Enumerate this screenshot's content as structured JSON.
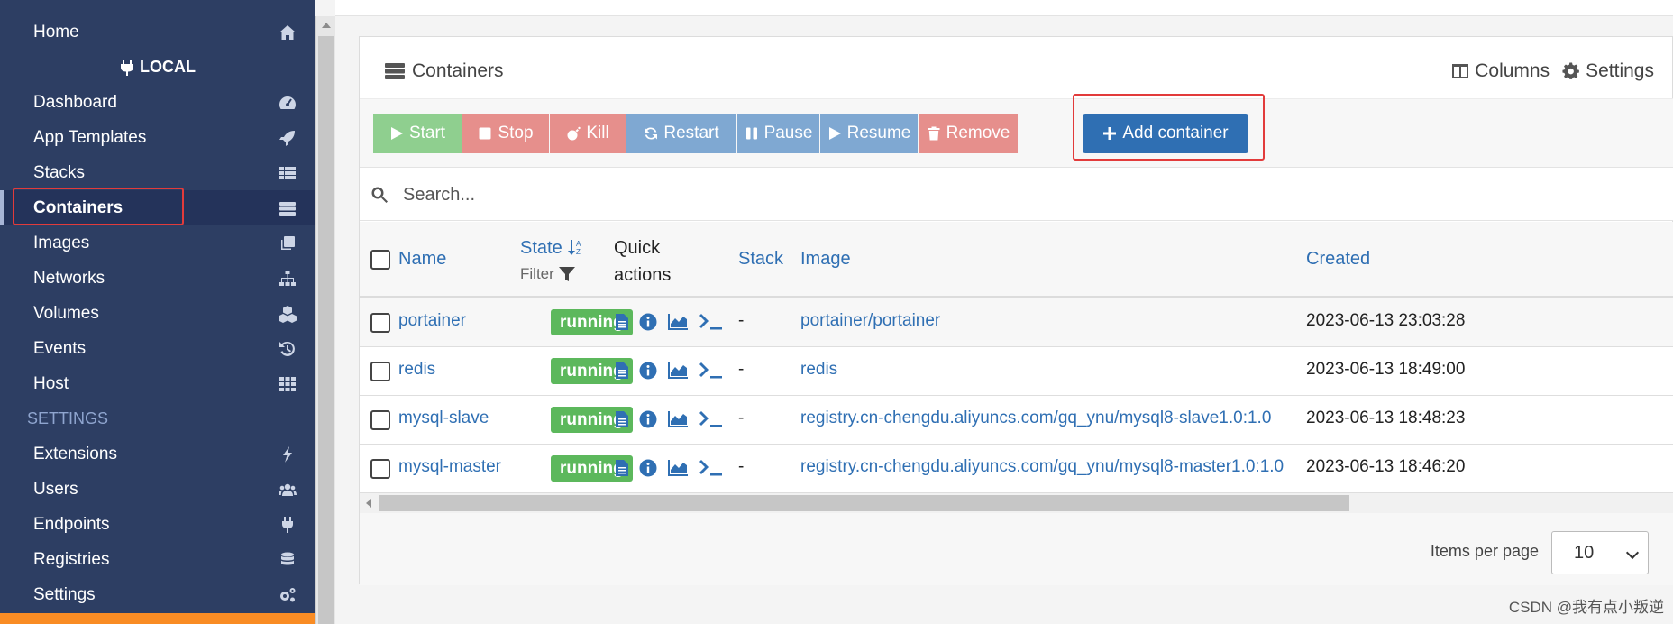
{
  "sidebar": {
    "home": "Home",
    "endpoint_header": "LOCAL",
    "items": [
      {
        "label": "Dashboard",
        "icon": "dashboard-icon"
      },
      {
        "label": "App Templates",
        "icon": "rocket-icon"
      },
      {
        "label": "Stacks",
        "icon": "list-icon"
      },
      {
        "label": "Containers",
        "icon": "server-icon"
      },
      {
        "label": "Images",
        "icon": "copy-icon"
      },
      {
        "label": "Networks",
        "icon": "sitemap-icon"
      },
      {
        "label": "Volumes",
        "icon": "cubes-icon"
      },
      {
        "label": "Events",
        "icon": "history-icon"
      },
      {
        "label": "Host",
        "icon": "grid-icon"
      }
    ],
    "settings_section": "SETTINGS",
    "settings_items": [
      {
        "label": "Extensions",
        "icon": "bolt-icon"
      },
      {
        "label": "Users",
        "icon": "users-icon"
      },
      {
        "label": "Endpoints",
        "icon": "plug-icon"
      },
      {
        "label": "Registries",
        "icon": "database-icon"
      },
      {
        "label": "Settings",
        "icon": "cogs-icon"
      }
    ],
    "accent_color": "#2d3e63"
  },
  "panel": {
    "title": "Containers",
    "columns_label": "Columns",
    "settings_label": "Settings"
  },
  "actions": {
    "start": "Start",
    "stop": "Stop",
    "kill": "Kill",
    "restart": "Restart",
    "pause": "Pause",
    "resume": "Resume",
    "remove": "Remove",
    "add": "Add container"
  },
  "search": {
    "placeholder": "Search..."
  },
  "table": {
    "headers": {
      "name": "Name",
      "state": "State",
      "filter": "Filter",
      "quick_actions_1": "Quick",
      "quick_actions_2": "actions",
      "stack": "Stack",
      "image": "Image",
      "created": "Created"
    },
    "rows": [
      {
        "name": "portainer",
        "state": "running",
        "stack": "-",
        "image": "portainer/portainer",
        "created": "2023-06-13 23:03:28"
      },
      {
        "name": "redis",
        "state": "running",
        "stack": "-",
        "image": "redis",
        "created": "2023-06-13 18:49:00"
      },
      {
        "name": "mysql-slave",
        "state": "running",
        "stack": "-",
        "image": "registry.cn-chengdu.aliyuncs.com/gq_ynu/mysql8-slave1.0:1.0",
        "created": "2023-06-13 18:48:23"
      },
      {
        "name": "mysql-master",
        "state": "running",
        "stack": "-",
        "image": "registry.cn-chengdu.aliyuncs.com/gq_ynu/mysql8-master1.0:1.0",
        "created": "2023-06-13 18:46:20"
      }
    ],
    "status_color": "#5cb85c"
  },
  "pagination": {
    "items_per_page_label": "Items per page",
    "items_per_page_value": "10"
  },
  "watermark": "CSDN @我有点小叛逆"
}
